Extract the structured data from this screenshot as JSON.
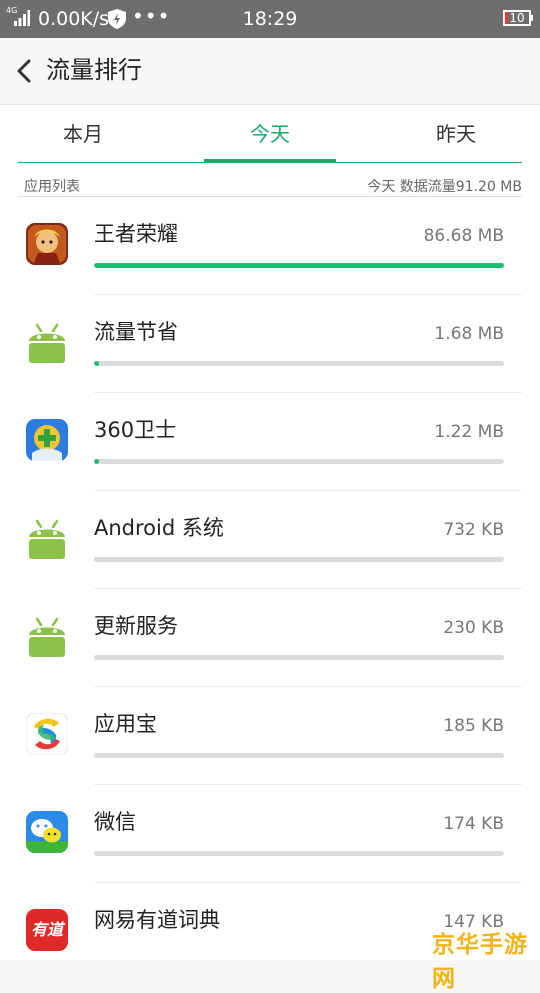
{
  "status_bar": {
    "network": "4G",
    "speed": "0.00K/s",
    "dots": "•••",
    "time": "18:29",
    "battery": "10"
  },
  "header": {
    "title": "流量排行"
  },
  "tabs": [
    {
      "label": "本月"
    },
    {
      "label": "今天",
      "active": true
    },
    {
      "label": "昨天"
    }
  ],
  "list_header": {
    "left": "应用列表",
    "right": "今天 数据流量91.20 MB"
  },
  "apps": [
    {
      "name": "王者荣耀",
      "size": "86.68 MB",
      "usage": 1.0,
      "icon": "honor-of-kings-icon"
    },
    {
      "name": "流量节省",
      "size": "1.68 MB",
      "usage": 0.012,
      "icon": "android-icon"
    },
    {
      "name": "360卫士",
      "size": "1.22 MB",
      "usage": 0.012,
      "icon": "360-security-icon"
    },
    {
      "name": "Android 系统",
      "size": "732 KB",
      "usage": 0.0,
      "icon": "android-icon"
    },
    {
      "name": "更新服务",
      "size": "230 KB",
      "usage": 0.0,
      "icon": "android-icon"
    },
    {
      "name": "应用宝",
      "size": "185 KB",
      "usage": 0.0,
      "icon": "app-store-icon"
    },
    {
      "name": "微信",
      "size": "174 KB",
      "usage": 0.0,
      "icon": "wechat-icon"
    },
    {
      "name": "网易有道词典",
      "size": "147 KB",
      "usage": 0.0,
      "icon": "youdao-dict-icon",
      "icon_text": "有道"
    }
  ],
  "watermark": "京华手游网",
  "colors": {
    "accent": "#1aa86b",
    "bar_fill": "#1ebd73",
    "status_bar": "#6e6e6e"
  }
}
